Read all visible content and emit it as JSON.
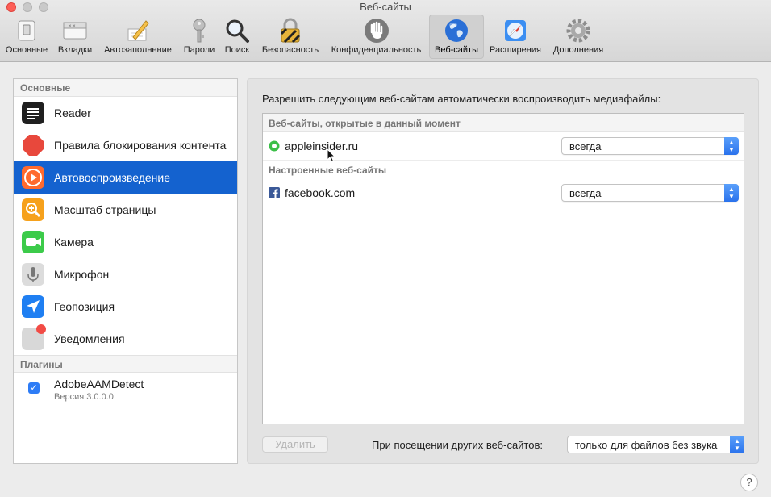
{
  "window": {
    "title": "Веб-сайты"
  },
  "toolbar": {
    "items": [
      {
        "label": "Основные",
        "icon": "general-switch-icon"
      },
      {
        "label": "Вкладки",
        "icon": "tabs-icon"
      },
      {
        "label": "Автозаполнение",
        "icon": "autofill-pencil-icon"
      },
      {
        "label": "Пароли",
        "icon": "key-icon"
      },
      {
        "label": "Поиск",
        "icon": "magnifier-icon"
      },
      {
        "label": "Безопасность",
        "icon": "lock-icon"
      },
      {
        "label": "Конфиденциальность",
        "icon": "hand-icon"
      },
      {
        "label": "Веб-сайты",
        "icon": "globe-icon",
        "active": true
      },
      {
        "label": "Расширения",
        "icon": "extensions-compass-icon"
      },
      {
        "label": "Дополнения",
        "icon": "gear-icon"
      }
    ]
  },
  "sidebar": {
    "section_general": "Основные",
    "items": [
      {
        "label": "Reader",
        "icon": "reader-icon"
      },
      {
        "label": "Правила блокирования контента",
        "icon": "stop-sign-icon"
      },
      {
        "label": "Автовоспроизведение",
        "icon": "play-icon",
        "selected": true
      },
      {
        "label": "Масштаб страницы",
        "icon": "zoom-icon"
      },
      {
        "label": "Камера",
        "icon": "camera-icon"
      },
      {
        "label": "Микрофон",
        "icon": "microphone-icon"
      },
      {
        "label": "Геопозиция",
        "icon": "location-arrow-icon"
      },
      {
        "label": "Уведомления",
        "icon": "notifications-icon"
      }
    ],
    "section_plugins": "Плагины",
    "plugin": {
      "name": "AdobeAAMDetect",
      "version": "Версия 3.0.0.0",
      "checked": true
    }
  },
  "panel": {
    "description": "Разрешить следующим веб-сайтам автоматически воспроизводить медиафайлы:",
    "group_open": "Веб-сайты, открытые в данный момент",
    "open_sites": [
      {
        "domain": "appleinsider.ru",
        "value": "всегда"
      }
    ],
    "group_configured": "Настроенные веб-сайты",
    "configured_sites": [
      {
        "domain": "facebook.com",
        "value": "всегда"
      }
    ],
    "delete_button": "Удалить",
    "other_sites_label": "При посещении других веб-сайтов:",
    "other_sites_value": "только для файлов без звука"
  },
  "help": {
    "label": "?"
  },
  "colors": {
    "selection": "#1462cf",
    "accent": "#2d7cf6"
  }
}
